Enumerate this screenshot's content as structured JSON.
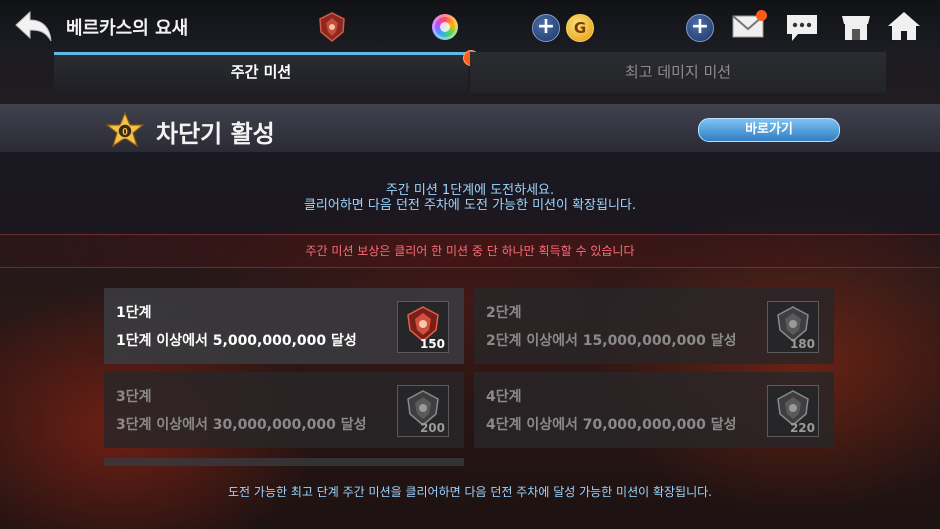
{
  "header": {
    "title": "베르카스의 요새"
  },
  "tabs": [
    {
      "label": "주간 미션",
      "active": true
    },
    {
      "label": "최고 데미지 미션",
      "active": false
    }
  ],
  "section": {
    "title": "차단기 활성",
    "go_button": "바로가기"
  },
  "info": {
    "line1": "주간 미션 1단계에 도전하세요.",
    "line2": "클리어하면 다음 던전 주차에 도전 가능한 미션이 확장됩니다."
  },
  "warning": "주간 미션 보상은 클리어 한 미션 중 단 하나만 획득할 수 있습니다",
  "stages": [
    {
      "name": "1단계",
      "desc": "1단계 이상에서 5,000,000,000 달성",
      "reward": "150",
      "active": true
    },
    {
      "name": "2단계",
      "desc": "2단계 이상에서 15,000,000,000 달성",
      "reward": "180",
      "active": false
    },
    {
      "name": "3단계",
      "desc": "3단계 이상에서 30,000,000,000 달성",
      "reward": "200",
      "active": false
    },
    {
      "name": "4단계",
      "desc": "4단계 이상에서 70,000,000,000 달성",
      "reward": "220",
      "active": false
    }
  ],
  "footer": "도전 가능한 최고 단계 주간 미션을 클리어하면 다음 던전 주차에 달성 가능한 미션이 확장됩니다.",
  "colors": {
    "accent": "#5fb9e8",
    "warning": "#ff6b7a",
    "info": "#9cd6ff",
    "notify": "#ff5e1a"
  }
}
